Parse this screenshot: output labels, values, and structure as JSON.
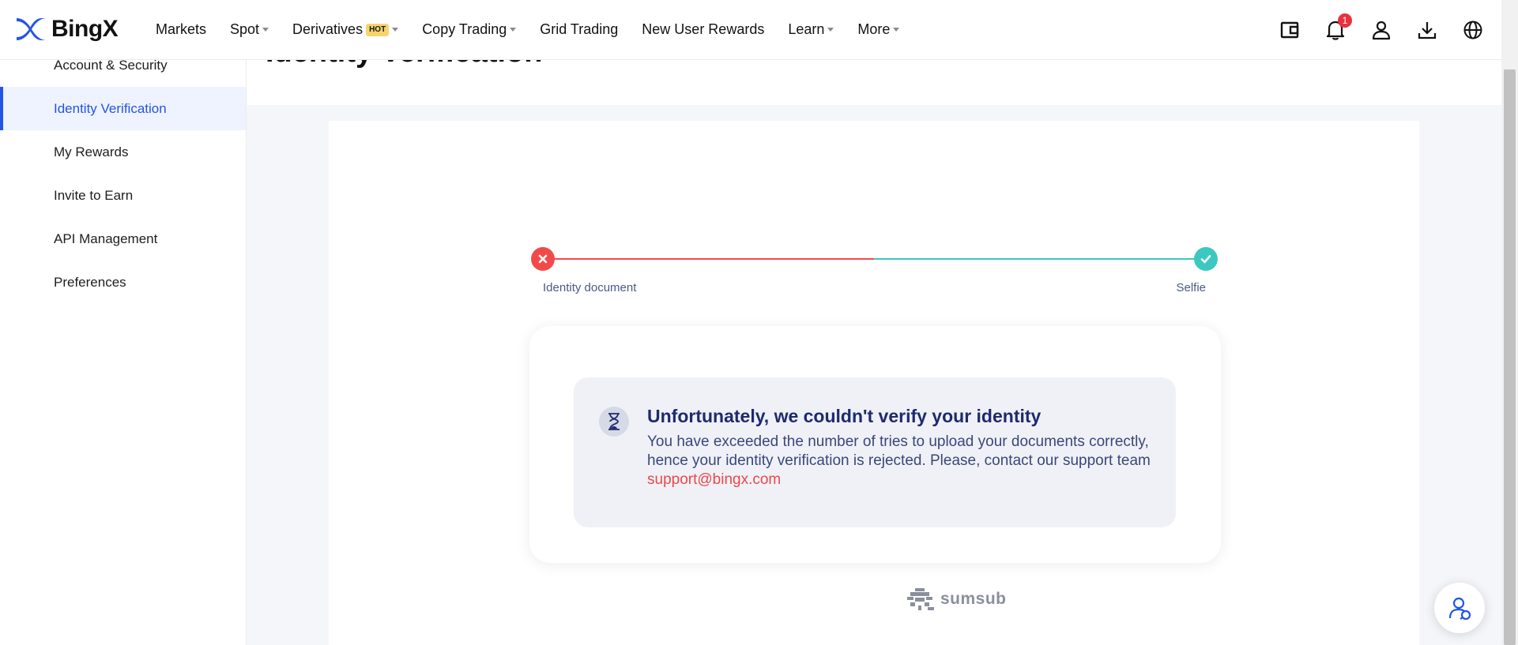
{
  "header": {
    "logo_text": "BingX",
    "nav": [
      {
        "label": "Markets"
      },
      {
        "label": "Spot"
      },
      {
        "label": "Derivatives",
        "badge": "HOT"
      },
      {
        "label": "Copy Trading"
      },
      {
        "label": "Grid Trading"
      },
      {
        "label": "New User Rewards"
      },
      {
        "label": "Learn"
      },
      {
        "label": "More"
      }
    ],
    "notification_count": "1",
    "icons": [
      "wallet-icon",
      "bell-icon",
      "user-icon",
      "download-icon",
      "globe-icon"
    ]
  },
  "sidebar": {
    "items": [
      {
        "label": "Account & Security"
      },
      {
        "label": "Identity Verification",
        "active": true
      },
      {
        "label": "My Rewards"
      },
      {
        "label": "Invite to Earn"
      },
      {
        "label": "API Management"
      },
      {
        "label": "Preferences"
      }
    ]
  },
  "main": {
    "page_title": "Identity Verification",
    "steps": [
      {
        "label": "Identity document",
        "status": "failed"
      },
      {
        "label": "Selfie",
        "status": "done"
      }
    ],
    "result": {
      "title": "Unfortunately, we couldn't verify your identity",
      "message": "You have exceeded the number of tries to upload your documents correctly, hence your identity verification is rejected. Please, contact our support team",
      "support_email": "support@bingx.com"
    },
    "powered_by": "sumsub"
  },
  "colors": {
    "accent": "#2354e6",
    "error": "#f24a4a",
    "success": "#3cc8c0",
    "link": "#e8484a"
  }
}
